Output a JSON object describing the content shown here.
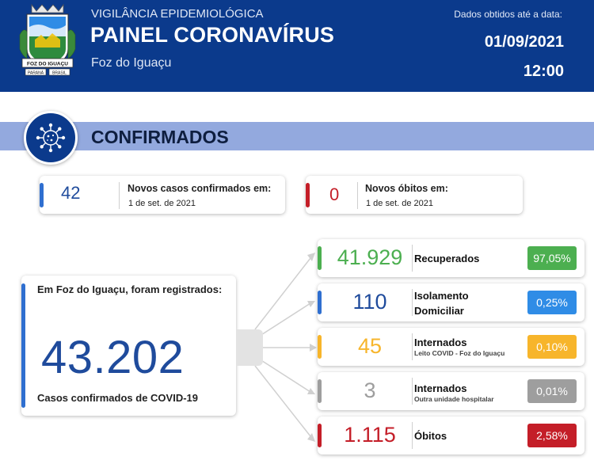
{
  "header": {
    "subtitle": "VIGILÂNCIA EPIDEMIOLÓGICA",
    "title": "PAINEL CORONAVÍRUS",
    "city": "Foz do Iguaçu",
    "data_label": "Dados obtidos até a data:",
    "date": "01/09/2021",
    "time": "12:00",
    "crest": {
      "banner": "FOZ DO IGUAÇU",
      "state": "PARANÁ",
      "country": "BRASIL"
    }
  },
  "section": {
    "title": "CONFIRMADOS",
    "icon": "virus-icon"
  },
  "new_cases": {
    "value": "42",
    "label": "Novos casos confirmados em:",
    "date": "1 de set. de 2021",
    "accent": "#2f6fd0"
  },
  "new_deaths": {
    "value": "0",
    "label": "Novos óbitos em:",
    "date": "1 de set. de 2021",
    "accent": "#c41e28"
  },
  "total": {
    "intro": "Em Foz do Iguaçu, foram registrados:",
    "value": "43.202",
    "label": "Casos confirmados de COVID-19",
    "accent": "#2f6fd0"
  },
  "rows": [
    {
      "value": "41.929",
      "title": "Recuperados",
      "title2": "",
      "small": "",
      "pct": "97,05%",
      "color": "#4caf50",
      "num_color": "#4caf50"
    },
    {
      "value": "110",
      "title": "Isolamento",
      "title2": "Domiciliar",
      "small": "",
      "pct": "0,25%",
      "color": "#2f8ce6",
      "num_color": "#1f4b9c"
    },
    {
      "value": "45",
      "title": "Internados",
      "title2": "",
      "small": "Leito COVID - Foz do Iguaçu",
      "pct": "0,10%",
      "color": "#f7b52b",
      "num_color": "#f7b52b"
    },
    {
      "value": "3",
      "title": "Internados",
      "title2": "",
      "small": "Outra unidade hospitalar",
      "pct": "0,01%",
      "color": "#9e9e9e",
      "num_color": "#9e9e9e"
    },
    {
      "value": "1.115",
      "title": "Óbitos",
      "title2": "",
      "small": "",
      "pct": "2,58%",
      "color": "#c41e28",
      "num_color": "#c41e28"
    }
  ]
}
